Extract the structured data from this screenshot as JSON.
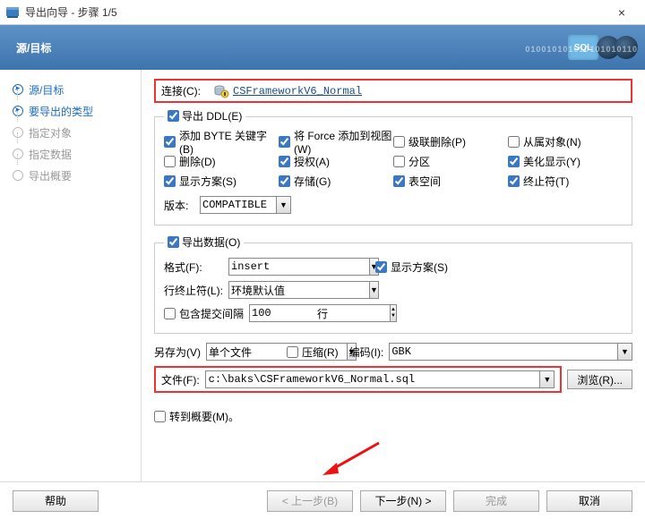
{
  "window": {
    "title": "导出向导 - 步骤 1/5",
    "close": "×"
  },
  "banner": {
    "title": "源/目标",
    "sql": "SQL",
    "binary": "010010101010101010110"
  },
  "sidebar": {
    "items": [
      {
        "label": "源/目标"
      },
      {
        "label": "要导出的类型"
      },
      {
        "label": "指定对象"
      },
      {
        "label": "指定数据"
      },
      {
        "label": "导出概要"
      }
    ]
  },
  "conn": {
    "label": "连接(C)",
    "value": "CSFrameworkV6_Normal"
  },
  "ddl": {
    "legend": "导出 DDL(E)",
    "opts": {
      "byte": "添加 BYTE 关键字(B)",
      "force": "将 Force 添加到视图(W)",
      "cascade": "级联删除(P)",
      "dependent": "从属对象(N)",
      "drop": "删除(D)",
      "grant": "授权(A)",
      "partition": "分区",
      "beautify": "美化显示(Y)",
      "schema": "显示方案(S)",
      "storage": "存储(G)",
      "tablespace": "表空间",
      "terminator": "终止符(T)"
    },
    "version_label": "版本:",
    "version_value": "COMPATIBLE"
  },
  "data": {
    "legend": "导出数据(O)",
    "format_label": "格式(F):",
    "format_value": "insert",
    "show_schema": "显示方案(S)",
    "line_term_label": "行终止符(L):",
    "line_term_value": "环境默认值",
    "commit_label": "包含提交间隔",
    "commit_value": "100",
    "commit_unit": "行"
  },
  "save": {
    "saveas_label": "另存为(V)",
    "saveas_value": "单个文件",
    "compress": "压缩(R)",
    "encoding_label": "编码(I):",
    "encoding_value": "GBK",
    "file_label": "文件(F):",
    "file_value": "c:\\baks\\CSFrameworkV6_Normal.sql",
    "browse": "浏览(R)..."
  },
  "summary": {
    "goto": "转到概要(M)。"
  },
  "footer": {
    "help": "帮助",
    "back": "< 上一步(B)",
    "next": "下一步(N) >",
    "finish": "完成",
    "cancel": "取消"
  }
}
